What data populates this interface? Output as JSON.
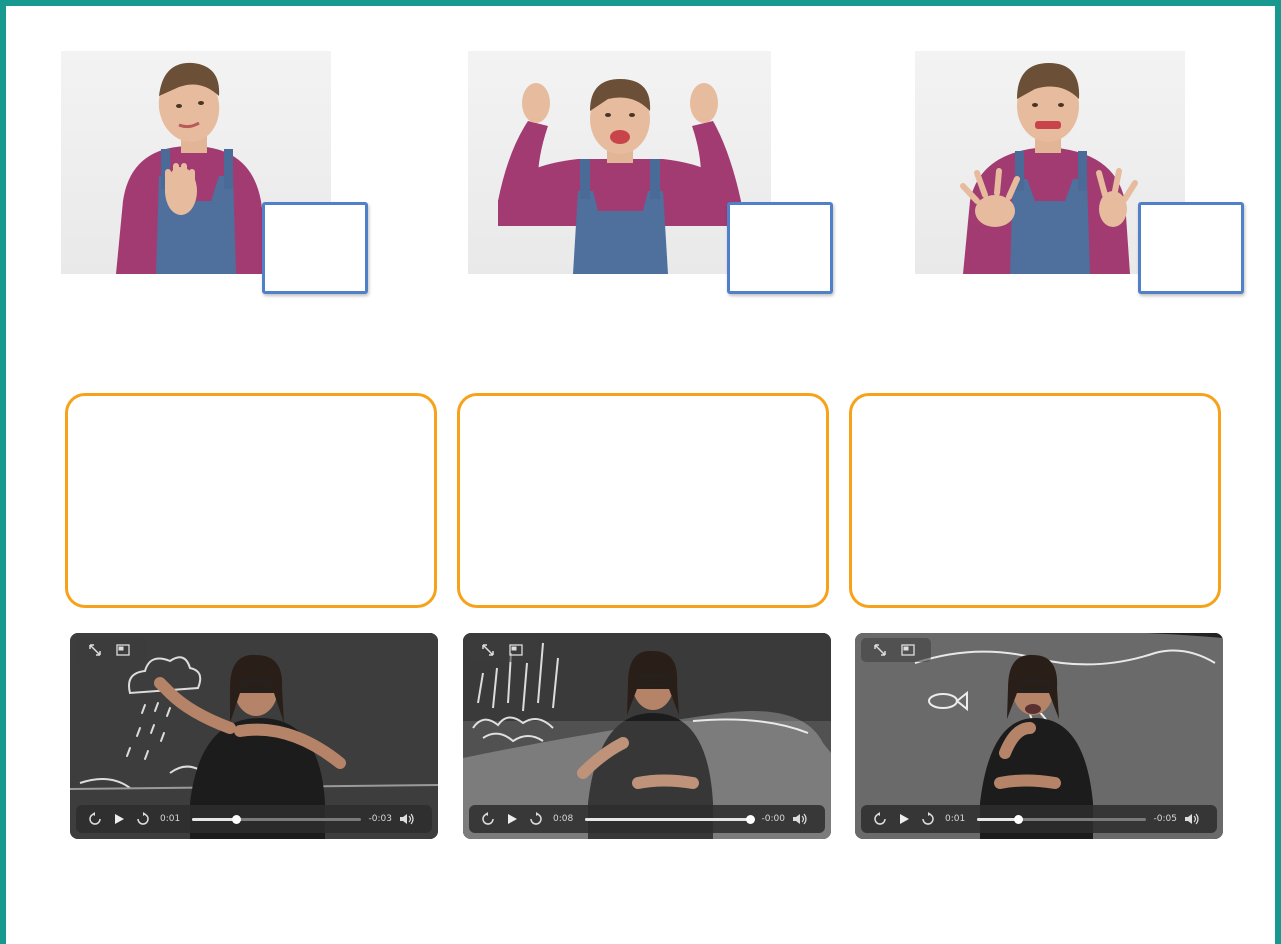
{
  "theme": {
    "frame_color": "#17998f",
    "answer_box_border": "#4f80c9",
    "drop_zone_border": "#f7a21b"
  },
  "photos": [
    {
      "name": "photo-woman-1",
      "pose": "head-tilt-wave"
    },
    {
      "name": "photo-woman-2",
      "pose": "hands-up-smile"
    },
    {
      "name": "photo-woman-3",
      "pose": "claws-grimace"
    }
  ],
  "videos": [
    {
      "current_time": "0:01",
      "remaining_time": "-0:03",
      "progress": 0.26,
      "icons": [
        "fullscreen-icon",
        "picture-in-picture-icon",
        "rewind-15-icon",
        "play-icon",
        "forward-15-icon",
        "volume-icon"
      ]
    },
    {
      "current_time": "0:08",
      "remaining_time": "-0:00",
      "progress": 0.98,
      "icons": [
        "fullscreen-icon",
        "picture-in-picture-icon",
        "rewind-15-icon",
        "play-icon",
        "forward-15-icon",
        "volume-icon"
      ]
    },
    {
      "current_time": "0:01",
      "remaining_time": "-0:05",
      "progress": 0.24,
      "icons": [
        "fullscreen-icon",
        "picture-in-picture-icon",
        "rewind-15-icon",
        "play-icon",
        "forward-15-icon",
        "volume-icon"
      ]
    }
  ]
}
